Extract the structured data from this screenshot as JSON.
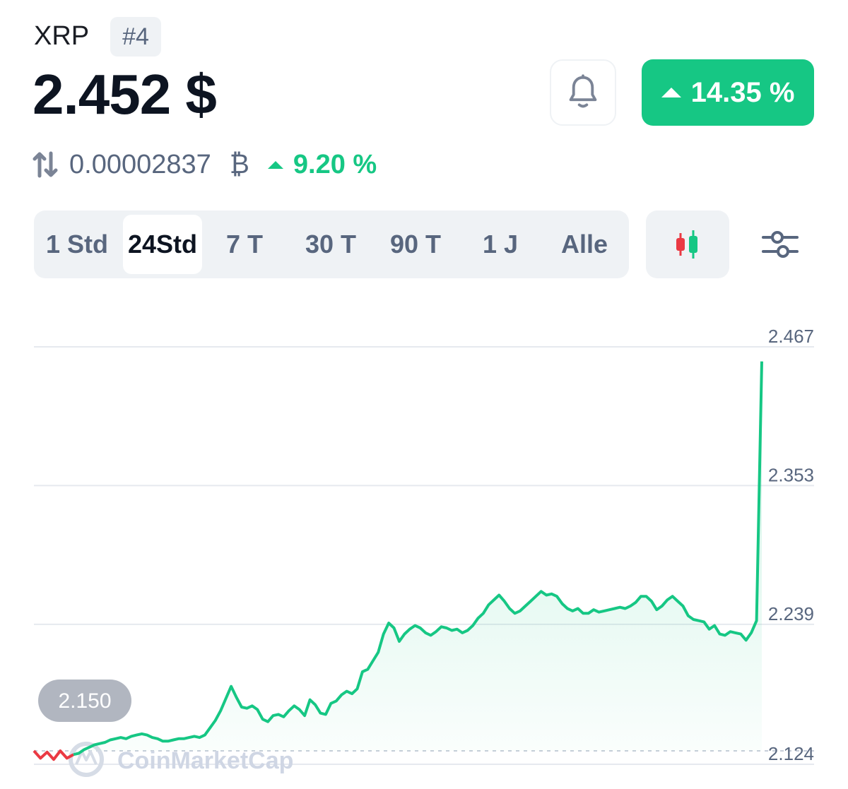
{
  "coin": {
    "symbol": "XRP",
    "rank": "#4",
    "price": "2.452 $",
    "change_24h": "14.35 %",
    "btc_price": "0.00002837",
    "btc_symbol": "₿",
    "btc_change": "9.20 %"
  },
  "colors": {
    "up": "#16c784",
    "down": "#ea3943",
    "muted": "#58667e"
  },
  "icons": {
    "bell": "bell-icon",
    "swap": "swap-arrows-icon",
    "candles": "candlestick-icon",
    "filter": "sliders-icon",
    "up": "triangle-up-icon"
  },
  "timeframes": {
    "selected": "24Std",
    "options": [
      "1 Std",
      "24Std",
      "7 T",
      "30 T",
      "90 T",
      "1 J",
      "Alle"
    ]
  },
  "chart_data": {
    "type": "line",
    "ylim": [
      2.124,
      2.467
    ],
    "y_ticks": [
      "2.467",
      "2.353",
      "2.239",
      "2.124"
    ],
    "reference_label": "2.150",
    "reference_value": 2.135,
    "watermark": "CoinMarketCap",
    "series": [
      {
        "color": "#16c784",
        "values": [
          2.132,
          2.133,
          2.136,
          2.138,
          2.14,
          2.141,
          2.142,
          2.144,
          2.145,
          2.146,
          2.145,
          2.147,
          2.148,
          2.149,
          2.148,
          2.146,
          2.145,
          2.143,
          2.143,
          2.144,
          2.145,
          2.145,
          2.146,
          2.147,
          2.146,
          2.148,
          2.154,
          2.16,
          2.168,
          2.178,
          2.188,
          2.179,
          2.171,
          2.17,
          2.172,
          2.169,
          2.161,
          2.159,
          2.164,
          2.165,
          2.163,
          2.168,
          2.172,
          2.169,
          2.164,
          2.177,
          2.173,
          2.166,
          2.165,
          2.174,
          2.176,
          2.181,
          2.184,
          2.182,
          2.186,
          2.2,
          2.202,
          2.209,
          2.216,
          2.231,
          2.24,
          2.236,
          2.225,
          2.231,
          2.235,
          2.238,
          2.236,
          2.232,
          2.23,
          2.233,
          2.237,
          2.236,
          2.234,
          2.235,
          2.232,
          2.234,
          2.238,
          2.244,
          2.248,
          2.255,
          2.259,
          2.263,
          2.258,
          2.252,
          2.248,
          2.25,
          2.254,
          2.258,
          2.262,
          2.266,
          2.263,
          2.264,
          2.262,
          2.256,
          2.252,
          2.25,
          2.252,
          2.248,
          2.248,
          2.251,
          2.249,
          2.25,
          2.251,
          2.252,
          2.253,
          2.252,
          2.254,
          2.257,
          2.262,
          2.262,
          2.258,
          2.251,
          2.254,
          2.259,
          2.262,
          2.258,
          2.254,
          2.246,
          2.243,
          2.242,
          2.241,
          2.235,
          2.238,
          2.231,
          2.23,
          2.233,
          2.232,
          2.231,
          2.226,
          2.232,
          2.242,
          2.455
        ]
      },
      {
        "color": "#ea3943",
        "values": [
          2.135,
          2.129,
          2.134,
          2.128,
          2.135,
          2.129,
          2.132
        ]
      }
    ]
  }
}
